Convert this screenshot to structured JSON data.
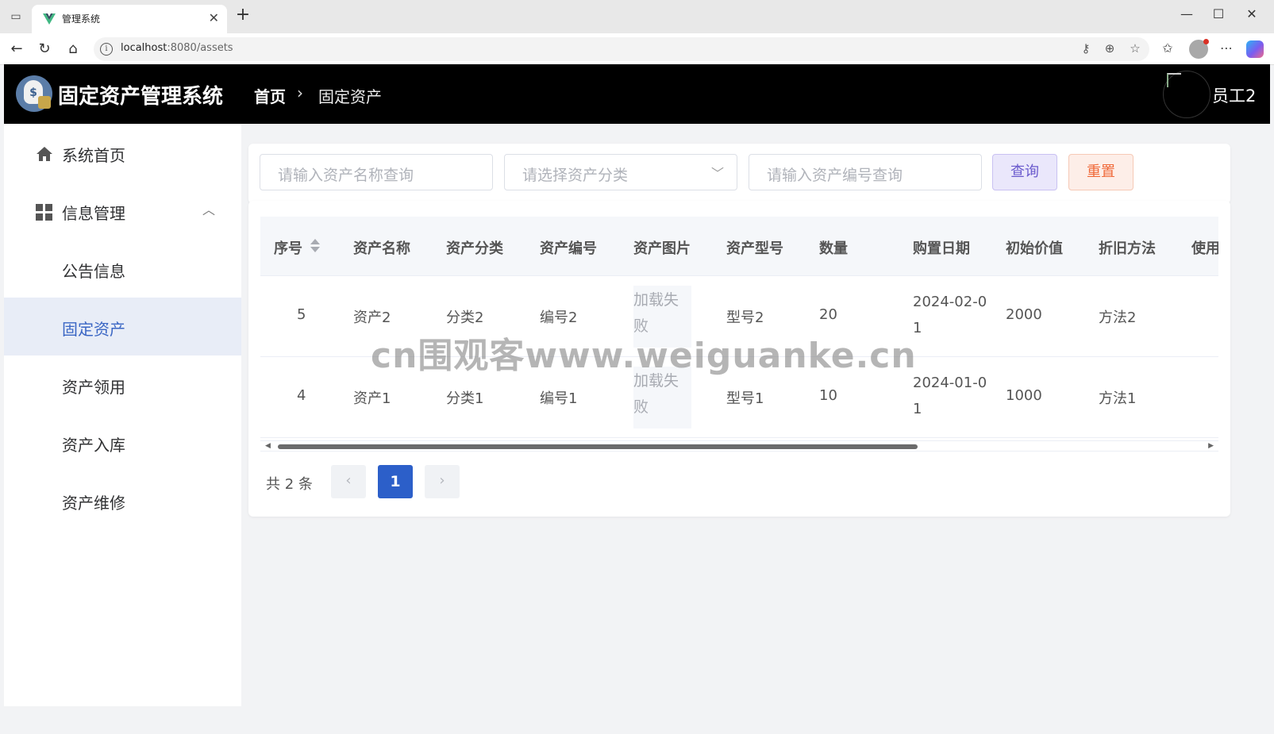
{
  "browser": {
    "tab_title": "管理系统",
    "url_host": "localhost",
    "url_rest": ":8080/assets"
  },
  "header": {
    "app_title": "固定资产管理系统",
    "breadcrumb_home": "首页",
    "breadcrumb_current": "固定资产",
    "username": "员工2"
  },
  "sidebar": {
    "items": [
      {
        "label": "系统首页"
      },
      {
        "label": "信息管理"
      },
      {
        "label": "公告信息"
      },
      {
        "label": "固定资产"
      },
      {
        "label": "资产领用"
      },
      {
        "label": "资产入库"
      },
      {
        "label": "资产维修"
      }
    ]
  },
  "search": {
    "name_placeholder": "请输入资产名称查询",
    "category_placeholder": "请选择资产分类",
    "code_placeholder": "请输入资产编号查询",
    "query_label": "查询",
    "reset_label": "重置"
  },
  "table": {
    "columns": [
      "序号",
      "资产名称",
      "资产分类",
      "资产编号",
      "资产图片",
      "资产型号",
      "数量",
      "购置日期",
      "初始价值",
      "折旧方法",
      "使用"
    ],
    "rows": [
      {
        "id": "5",
        "name": "资产2",
        "category": "分类2",
        "code": "编号2",
        "image": "加载失败",
        "model": "型号2",
        "qty": "20",
        "date": "2024-02-01",
        "value": "2000",
        "method": "方法2"
      },
      {
        "id": "4",
        "name": "资产1",
        "category": "分类1",
        "code": "编号1",
        "image": "加载失败",
        "model": "型号1",
        "qty": "10",
        "date": "2024-01-01",
        "value": "1000",
        "method": "方法1"
      }
    ]
  },
  "pagination": {
    "total_text": "共 2 条",
    "prev": "‹",
    "current": "1",
    "next": "›"
  },
  "watermark": "cn围观客www.weiguanke.cn",
  "colors": {
    "header_bg": "#000000",
    "active_menu": "#3a66c4",
    "pager_active": "#2c5fc9"
  }
}
